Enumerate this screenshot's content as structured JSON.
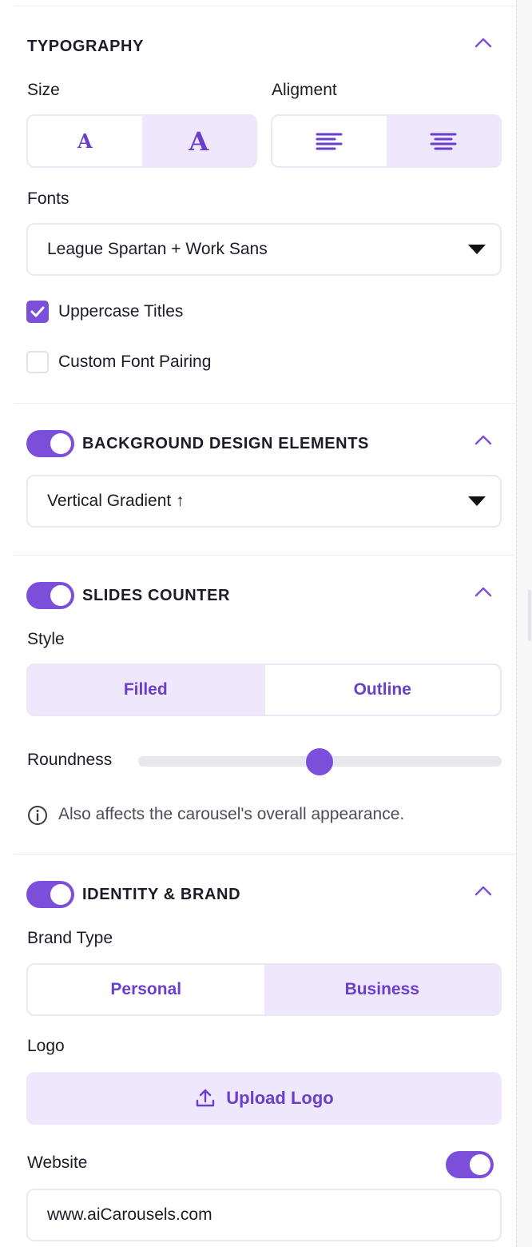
{
  "colors": {
    "accent": "#7c4fdb",
    "accent_text": "#6b3ecc",
    "accent_soft": "#efe7fb"
  },
  "typography": {
    "title": "TYPOGRAPHY",
    "size_label": "Size",
    "alignment_label": "Aligment",
    "size_options": [
      {
        "glyph": "A",
        "selected": false
      },
      {
        "glyph": "A",
        "selected": true
      }
    ],
    "alignment_options": [
      {
        "icon": "align-left-icon",
        "selected": false
      },
      {
        "icon": "align-center-icon",
        "selected": true
      }
    ],
    "fonts_label": "Fonts",
    "fonts_value": "League Spartan + Work Sans",
    "uppercase_titles": {
      "label": "Uppercase Titles",
      "checked": true
    },
    "custom_font_pairing": {
      "label": "Custom Font Pairing",
      "checked": false
    }
  },
  "background": {
    "title": "BACKGROUND DESIGN ELEMENTS",
    "enabled": true,
    "value": "Vertical Gradient ↑"
  },
  "slides_counter": {
    "title": "SLIDES COUNTER",
    "enabled": true,
    "style_label": "Style",
    "style_options": [
      {
        "label": "Filled",
        "selected": true
      },
      {
        "label": "Outline",
        "selected": false
      }
    ],
    "roundness_label": "Roundness",
    "roundness_value": 0.5,
    "info_text": "Also affects the carousel's overall appearance."
  },
  "identity": {
    "title": "IDENTITY & BRAND",
    "enabled": true,
    "brand_type_label": "Brand Type",
    "brand_options": [
      {
        "label": "Personal",
        "selected": false
      },
      {
        "label": "Business",
        "selected": true
      }
    ],
    "logo_label": "Logo",
    "upload_label": "Upload Logo",
    "website_label": "Website",
    "website_enabled": true,
    "website_value": "www.aiCarousels.com"
  }
}
